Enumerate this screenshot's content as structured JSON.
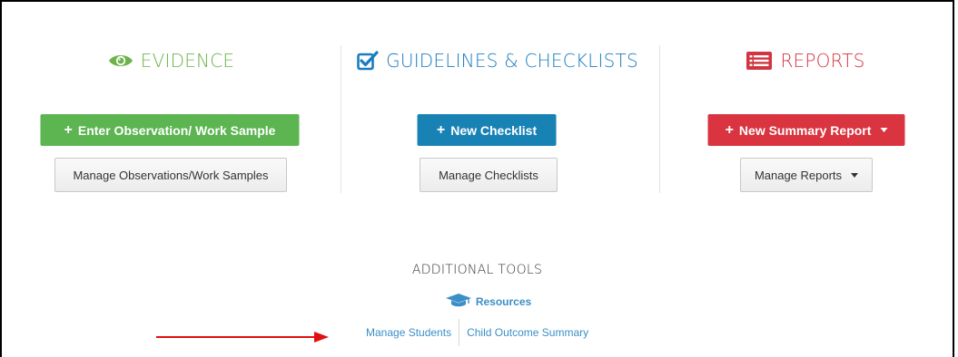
{
  "colors": {
    "evidence": "#6bb34a",
    "guidelines": "#1a7cc0",
    "reports": "#d23441",
    "evidence_button": "#5cb551",
    "checklist_button": "#1982b5",
    "report_button": "#d9343f",
    "link": "#3a8fc6",
    "arrow": "#e01010"
  },
  "evidence": {
    "icon": "eye-icon",
    "title": "EVIDENCE",
    "primary_label": "Enter Observation/ Work Sample",
    "secondary_label": "Manage Observations/Work Samples"
  },
  "guidelines": {
    "icon": "checkbox-icon",
    "title": "GUIDELINES & CHECKLISTS",
    "primary_label": "New Checklist",
    "secondary_label": "Manage Checklists"
  },
  "reports": {
    "icon": "report-list-icon",
    "title": "REPORTS",
    "primary_label": "New Summary Report",
    "secondary_label": "Manage Reports"
  },
  "additional_tools": {
    "title": "ADDITIONAL TOOLS",
    "resources_icon": "graduation-cap-icon",
    "resources_label": "Resources",
    "links": [
      "Manage Students",
      "Child Outcome Summary"
    ]
  }
}
